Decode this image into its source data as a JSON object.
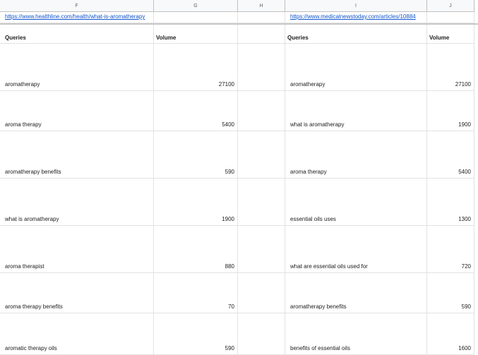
{
  "columns": [
    "F",
    "G",
    "H",
    "I",
    "J"
  ],
  "links": {
    "left": "https://www.healthline.com/health/what-is-aromatherapy",
    "right": "https://www.medicalnewstoday.com/articles/10884"
  },
  "headers": {
    "queries": "Queries",
    "volume": "Volume"
  },
  "left_table": [
    {
      "query": "aromatherapy",
      "volume": "27100"
    },
    {
      "query": "aroma therapy",
      "volume": "5400"
    },
    {
      "query": "aromatherapy benefits",
      "volume": "590"
    },
    {
      "query": "what is aromatherapy",
      "volume": "1900"
    },
    {
      "query": "aroma therapist",
      "volume": "880"
    },
    {
      "query": "aroma therapy benefits",
      "volume": "70"
    },
    {
      "query": "aromatic therapy oils",
      "volume": "590"
    }
  ],
  "right_table": [
    {
      "query": "aromatherapy",
      "volume": "27100"
    },
    {
      "query": "what is aromatherapy",
      "volume": "1900"
    },
    {
      "query": "aroma therapy",
      "volume": "5400"
    },
    {
      "query": "essential oils uses",
      "volume": "1300"
    },
    {
      "query": "what are essential oils used for",
      "volume": "720"
    },
    {
      "query": "aromatherapy benefits",
      "volume": "590"
    },
    {
      "query": "benefits of essential oils",
      "volume": "1600"
    }
  ]
}
